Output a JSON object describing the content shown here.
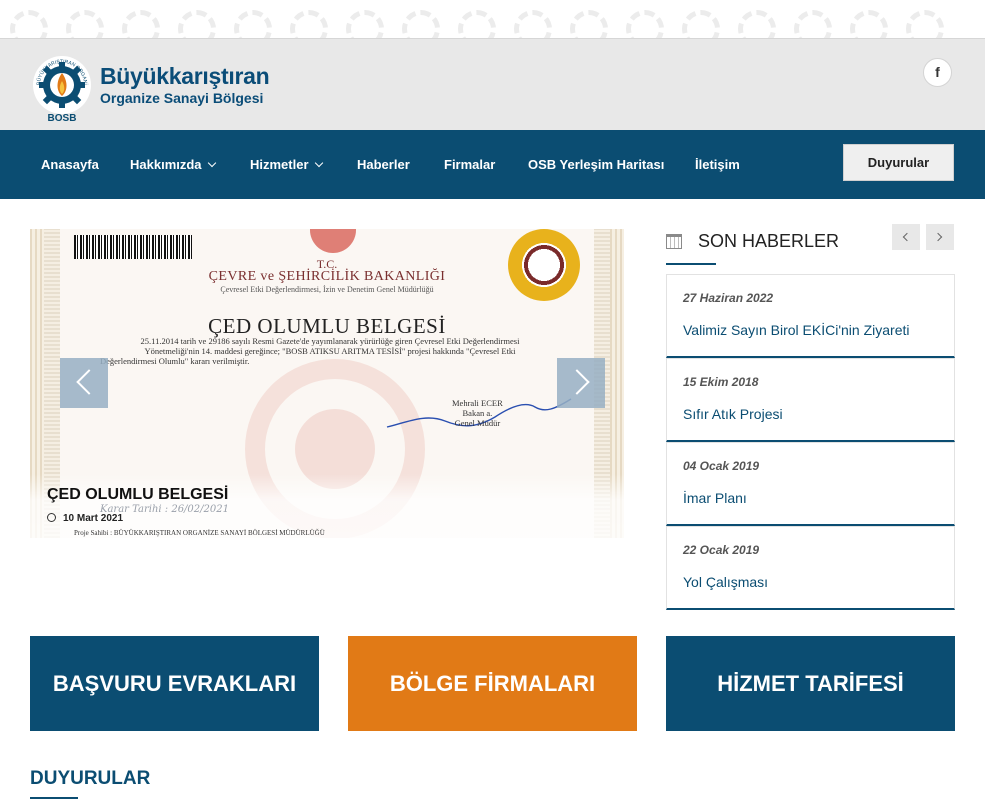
{
  "colors": {
    "primary": "#0b4d72",
    "accent": "#e17a16",
    "header_bg": "#e8e8e8"
  },
  "brand": {
    "title": "Büyükkarıştıran",
    "subtitle": "Organize Sanayi Bölgesi",
    "logo_text": "BOSB",
    "logo_arc_text": "BÜYÜKKARIŞTIRAN ORGANİZE SANAYİ"
  },
  "social": {
    "facebook_icon": "f"
  },
  "nav": {
    "items": [
      {
        "label": "Anasayfa"
      },
      {
        "label": "Hakkımızda"
      },
      {
        "label": "Hizmetler"
      },
      {
        "label": "Haberler"
      },
      {
        "label": "Firmalar"
      },
      {
        "label": "OSB Yerleşim Haritası"
      },
      {
        "label": "İletişim"
      }
    ],
    "button": "Duyurular"
  },
  "slider": {
    "title": "ÇED OLUMLU BELGESİ",
    "date": "10 Mart 2021",
    "certificate": {
      "tc": "T.C.",
      "ministry": "ÇEVRE ve ŞEHİRCİLİK BAKANLIĞI",
      "department": "Çevresel Etki Değerlendirmesi, İzin ve Denetim Genel Müdürlüğü",
      "title": "ÇED OLUMLU BELGESİ",
      "body_1": "25.11.2014 tarih ve 29186 sayılı Resmi Gazete'de yayımlanarak yürürlüğe giren Çevresel Etki Değerlendirmesi",
      "body_2": "Yönetmeliği'nin 14. maddesi gereğince; \"BOSB ATIKSU ARITMA TESİSİ\" projesi hakkında \"Çevresel Etki",
      "body_3": "Değerlendirmesi Olumlu\" kararı verilmiştir.",
      "signer_name": "Mehrali ECER",
      "signer_role_1": "Bakan a.",
      "signer_role_2": "Genel Müdür",
      "hand_date": "Karar Tarihi : 26/02/2021",
      "footer": "Proje Sahibi : BÜYÜKKARIŞTIRAN ORGANİZE SANAYİ BÖLGESİ MÜDÜRLÜĞÜ"
    }
  },
  "news": {
    "title": "SON HABERLER",
    "items": [
      {
        "date": "27 Haziran 2022",
        "title": "Valimiz Sayın Birol EKİCi'nin Ziyareti"
      },
      {
        "date": "15 Ekim 2018",
        "title": "Sıfır Atık Projesi"
      },
      {
        "date": "04 Ocak 2019",
        "title": "İmar Planı"
      },
      {
        "date": "22 Ocak 2019",
        "title": "Yol Çalışması"
      }
    ]
  },
  "tiles": [
    {
      "label": "BAŞVURU EVRAKLARI",
      "color": "#0b4d72"
    },
    {
      "label": "BÖLGE FİRMALARI",
      "color": "#e17a16"
    },
    {
      "label": "HİZMET TARİFESİ",
      "color": "#0b4d72"
    }
  ],
  "announcements": {
    "title": "DUYURULAR"
  }
}
